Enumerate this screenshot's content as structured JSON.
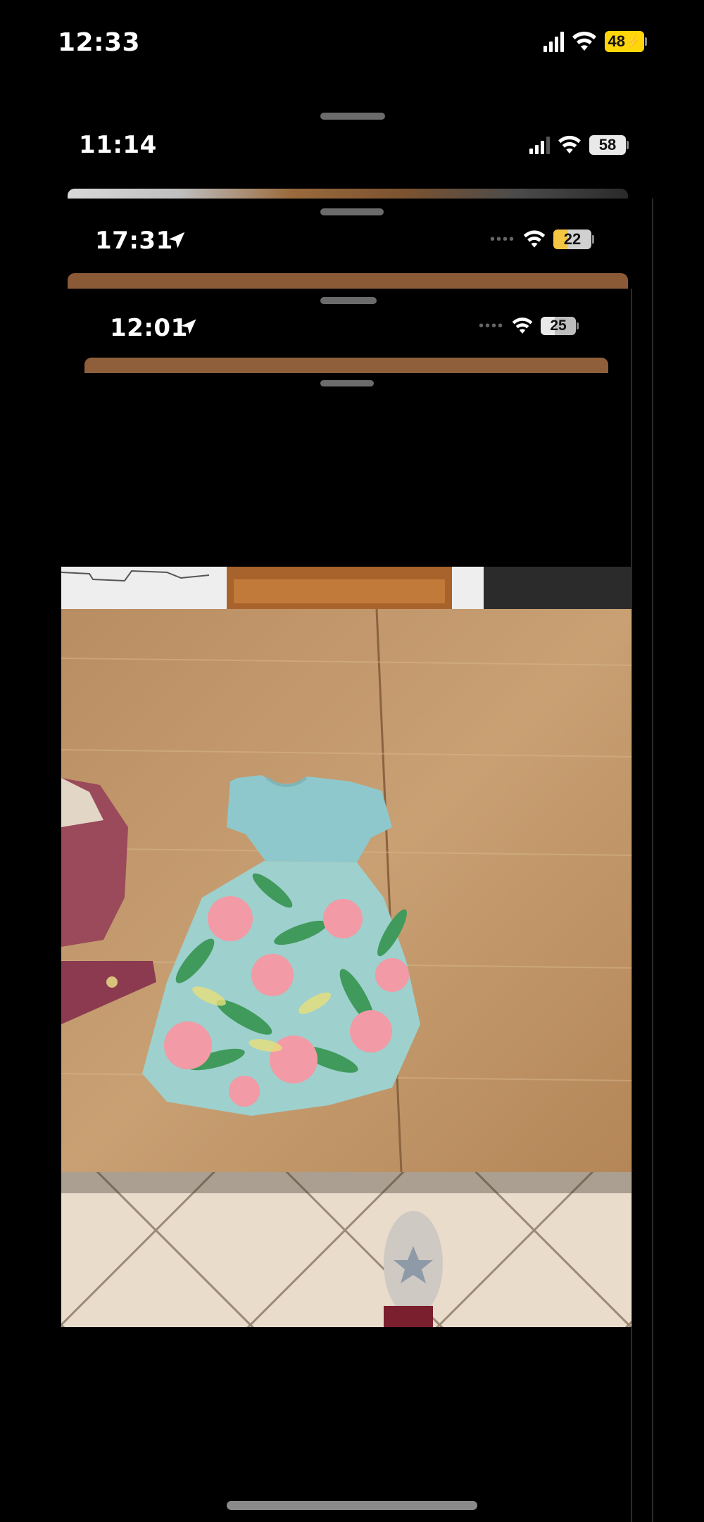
{
  "status_bars": [
    {
      "time": "12:33",
      "battery": "48",
      "location": false
    },
    {
      "time": "11:14",
      "battery": "58",
      "location": false
    },
    {
      "time": "17:31",
      "battery": "22",
      "location": true
    },
    {
      "time": "12:01",
      "battery": "25",
      "location": true
    }
  ],
  "photo": {
    "subject": "floral dress on wooden table"
  },
  "colors": {
    "background": "#000000",
    "battery_charging": "#ffd60a",
    "battery_low": "#f4c542",
    "battery_normal": "#e9e9e9",
    "table_wood": "#c49a6c",
    "dress_top": "#8fc8cc",
    "dress_skirt_flowers": "#f29aa5",
    "dress_leaves": "#3f9a5c"
  }
}
